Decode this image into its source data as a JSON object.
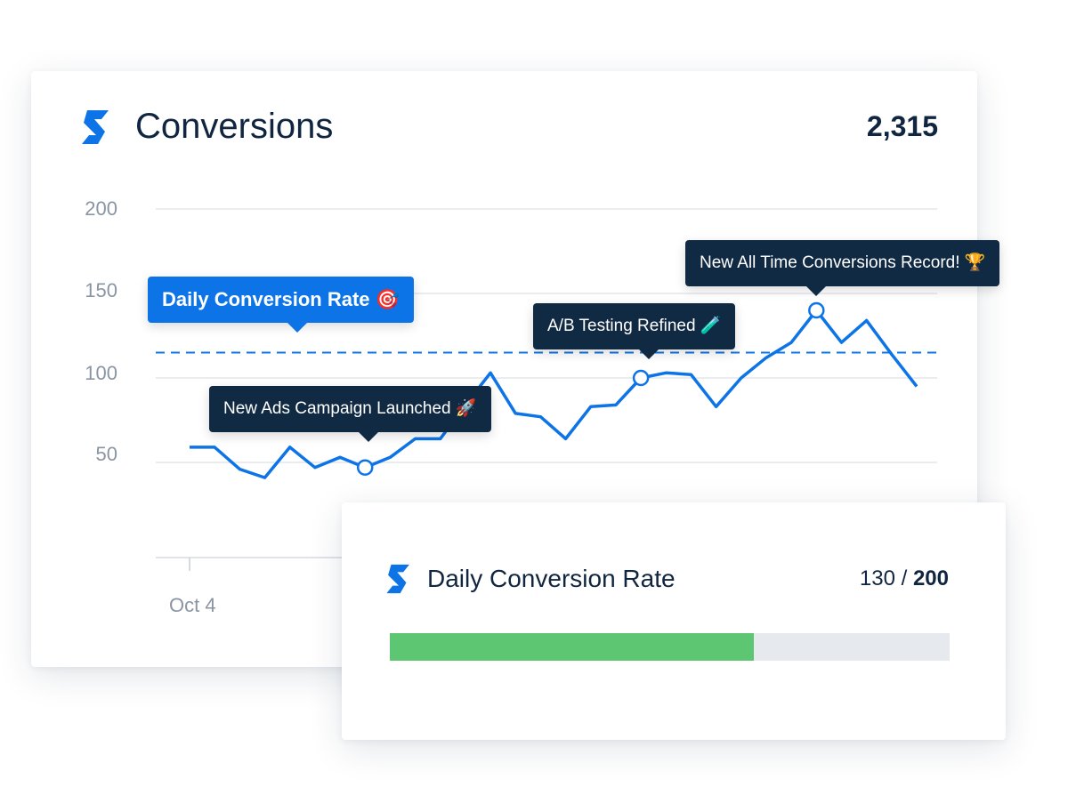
{
  "main_card": {
    "title": "Conversions",
    "total": "2,315",
    "logo_icon": "s-logo-icon",
    "brand_color": "#0d74e8"
  },
  "chart_data": {
    "type": "line",
    "y_ticks": [
      "200",
      "150",
      "100",
      "50"
    ],
    "ylim": [
      0,
      200
    ],
    "x_tick_labels": [
      "Oct 4"
    ],
    "grid": true,
    "line_color": "#0d74e8",
    "values": [
      59,
      59,
      46,
      41,
      59,
      47,
      53,
      47,
      53,
      64,
      64,
      84,
      103,
      79,
      77,
      64,
      83,
      84,
      100,
      103,
      102,
      83,
      100,
      112,
      121,
      140,
      121,
      134,
      114,
      95
    ],
    "target": {
      "label": "Daily Conversion Rate 🎯",
      "value": 115
    },
    "annotations": [
      {
        "index": 7,
        "label": "New Ads Campaign Launched 🚀"
      },
      {
        "index": 18,
        "label": "A/B Testing Refined 🧪"
      },
      {
        "index": 25,
        "label": "New All Time Conversions Record! 🏆"
      }
    ]
  },
  "goal_card": {
    "title": "Daily Conversion Rate",
    "current": "130",
    "separator": " / ",
    "goal": "200",
    "progress_fraction": 0.65,
    "progress_color": "#5cc672",
    "track_color": "#e6eaee"
  }
}
